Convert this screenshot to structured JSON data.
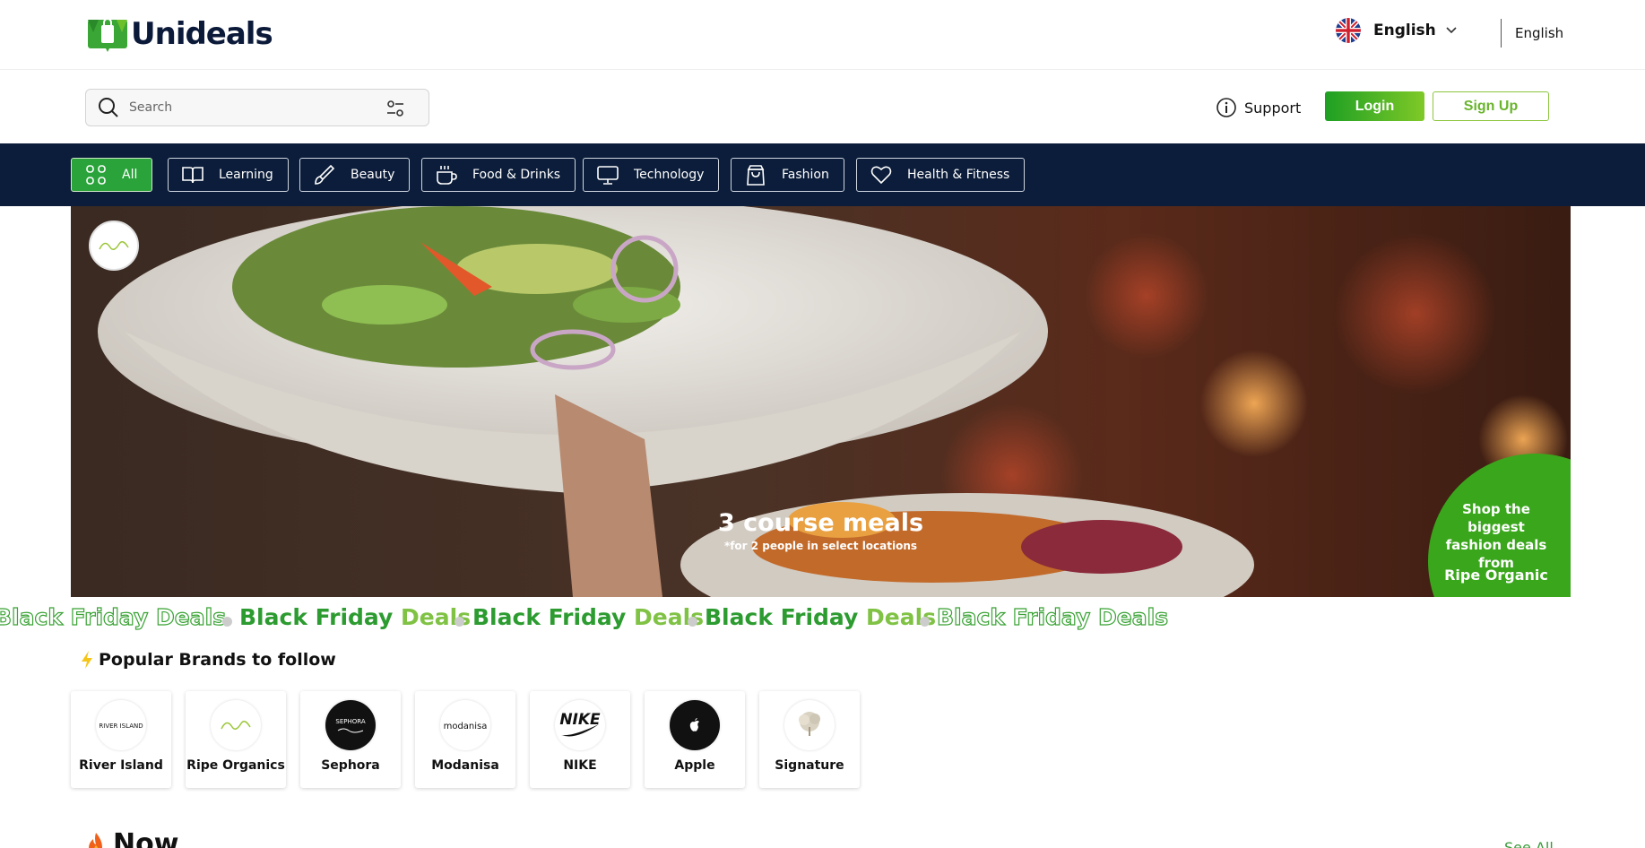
{
  "header": {
    "brand": "Unideals",
    "language": "English",
    "language_secondary": "English"
  },
  "search": {
    "placeholder": "Search"
  },
  "actions": {
    "support": "Support",
    "login": "Login",
    "signup": "Sign Up"
  },
  "categories": [
    {
      "label": "All",
      "icon": "grid-icon",
      "active": true
    },
    {
      "label": "Learning",
      "icon": "book-icon",
      "active": false
    },
    {
      "label": "Beauty",
      "icon": "brush-icon",
      "active": false
    },
    {
      "label": "Food & Drinks",
      "icon": "cup-icon",
      "active": false
    },
    {
      "label": "Technology",
      "icon": "monitor-icon",
      "active": false
    },
    {
      "label": "Fashion",
      "icon": "bag-icon",
      "active": false
    },
    {
      "label": "Health & Fitness",
      "icon": "heart-icon",
      "active": false
    }
  ],
  "hero": {
    "title": "3 course meals",
    "subtitle": "*for 2 people in select locations",
    "promo_text": "Shop the biggest fashion deals from",
    "promo_brand": "Ripe Organic"
  },
  "marquee": {
    "word1": "Black Friday",
    "word2": "Deals"
  },
  "popular_brands": {
    "title": "Popular Brands to follow",
    "items": [
      {
        "name": "River Island"
      },
      {
        "name": "Ripe Organics"
      },
      {
        "name": "Sephora"
      },
      {
        "name": "Modanisa"
      },
      {
        "name": "NIKE"
      },
      {
        "name": "Apple"
      },
      {
        "name": "Signature"
      }
    ]
  },
  "now_section": {
    "title": "Now",
    "see_all": "See All"
  },
  "colors": {
    "brand_green": "#29a33a",
    "nav_navy": "#0b1d3a",
    "logo_navy": "#0c1a3a"
  }
}
